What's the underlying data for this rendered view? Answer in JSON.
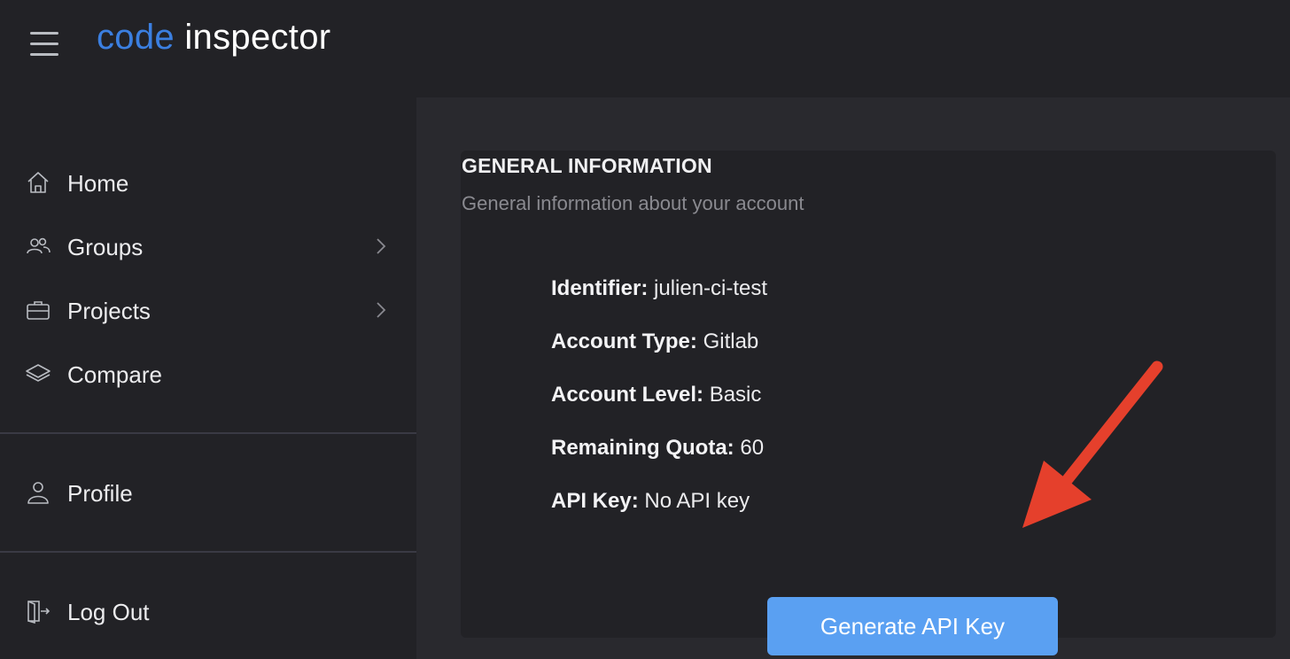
{
  "header": {
    "logo_part1": "code",
    "logo_part2": "inspector",
    "menu_icon": "hamburger-menu-icon"
  },
  "sidebar": {
    "items": [
      {
        "label": "Home",
        "icon": "home-icon",
        "has_chevron": false
      },
      {
        "label": "Groups",
        "icon": "users-icon",
        "has_chevron": true
      },
      {
        "label": "Projects",
        "icon": "briefcase-icon",
        "has_chevron": true
      },
      {
        "label": "Compare",
        "icon": "layers-icon",
        "has_chevron": false
      },
      {
        "label": "Profile",
        "icon": "user-icon",
        "has_chevron": false
      },
      {
        "label": "Log Out",
        "icon": "logout-icon",
        "has_chevron": false
      }
    ]
  },
  "main": {
    "title": "GENERAL INFORMATION",
    "subtitle": "General information about your account",
    "fields": [
      {
        "label": "Identifier:",
        "value": "julien-ci-test"
      },
      {
        "label": "Account Type:",
        "value": "Gitlab"
      },
      {
        "label": "Account Level:",
        "value": "Basic"
      },
      {
        "label": "Remaining Quota:",
        "value": "60"
      },
      {
        "label": "API Key:",
        "value": "No API key"
      }
    ],
    "button_label": "Generate API Key"
  },
  "colors": {
    "background": "#222226",
    "panel": "#29292e",
    "accent_logo": "#3b7fe0",
    "button": "#5aa0f2",
    "annotation_arrow": "#e5402c"
  }
}
